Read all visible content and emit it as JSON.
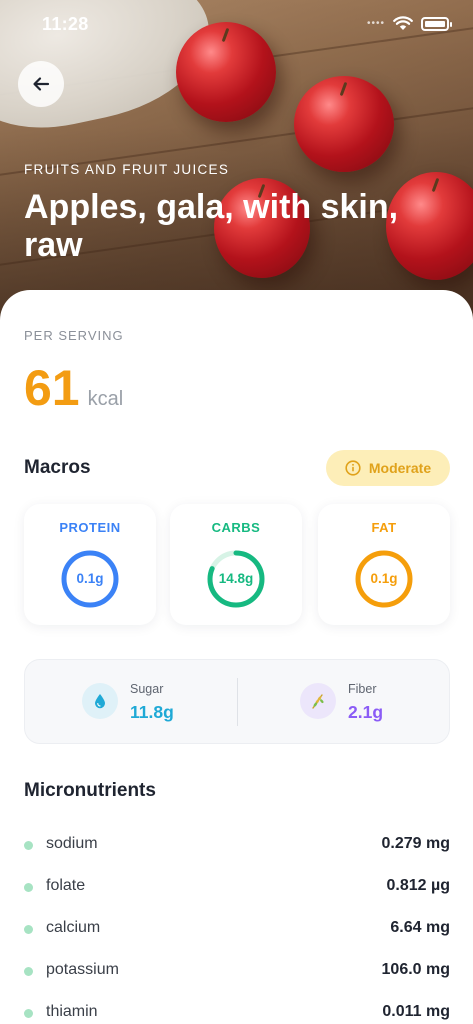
{
  "status_bar": {
    "time": "11:28"
  },
  "hero": {
    "category": "FRUITS AND FRUIT JUICES",
    "title": "Apples, gala, with skin, raw",
    "back_icon": "arrow-left-icon"
  },
  "summary": {
    "per_serving_label": "PER SERVING",
    "kcal_value": "61",
    "kcal_unit": "kcal"
  },
  "macros": {
    "title": "Macros",
    "badge": {
      "label": "Moderate",
      "icon": "info-circle-icon",
      "color": "#e0a21b"
    },
    "items": [
      {
        "label": "PROTEIN",
        "value": "0.1g",
        "color": "#3b82f6"
      },
      {
        "label": "CARBS",
        "value": "14.8g",
        "color": "#16b981"
      },
      {
        "label": "FAT",
        "value": "0.1g",
        "color": "#f59e0b"
      }
    ]
  },
  "sugar_fiber": {
    "sugar": {
      "name": "Sugar",
      "value": "11.8g",
      "icon": "water-drop-icon",
      "color": "#1fa9d6"
    },
    "fiber": {
      "name": "Fiber",
      "value": "2.1g",
      "icon": "wheat-icon",
      "color": "#8b5cf6"
    }
  },
  "micronutrients": {
    "title": "Micronutrients",
    "items": [
      {
        "name": "sodium",
        "value": "0.279 mg"
      },
      {
        "name": "folate",
        "value": "0.812 µg"
      },
      {
        "name": "calcium",
        "value": "6.64 mg"
      },
      {
        "name": "potassium",
        "value": "106.0 mg"
      },
      {
        "name": "thiamin",
        "value": "0.011 mg"
      }
    ]
  }
}
